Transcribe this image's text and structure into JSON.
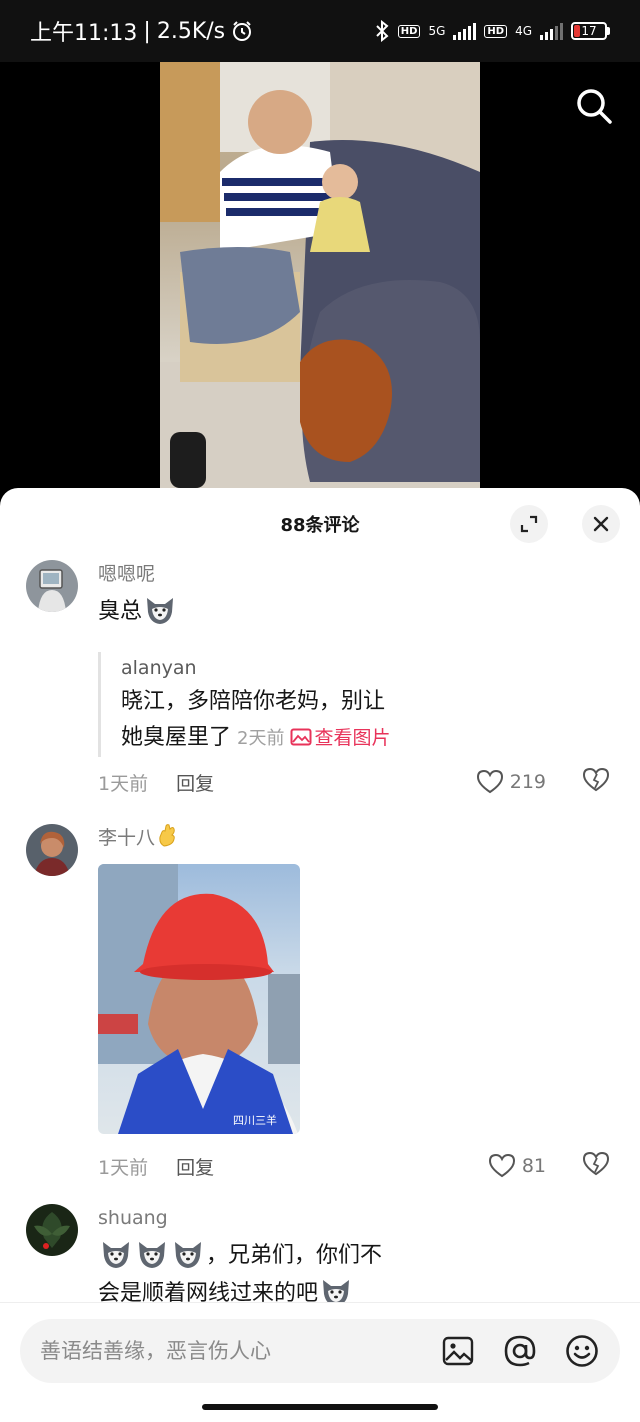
{
  "status_bar": {
    "time": "上午11:13",
    "network_speed": "2.5K/s",
    "signal_1": "5G",
    "signal_2": "4G",
    "hd_label": "HD",
    "battery": "17"
  },
  "comments_sheet": {
    "title": "88条评论"
  },
  "comments": [
    {
      "username": "嗯嗯呢",
      "text": "臭总",
      "quote": {
        "username": "alanyan",
        "line1": "晓江，多陪陪你老妈，别让",
        "line2": "她臭屋里了",
        "time": "2天前",
        "view_image": "查看图片"
      },
      "time": "1天前",
      "reply": "回复",
      "likes": "219"
    },
    {
      "username": "李十八",
      "time": "1天前",
      "reply": "回复",
      "likes": "81"
    },
    {
      "username": "shuang",
      "line1": "，兄弟们，你们不",
      "line2": "会是顺着网线过来的吧"
    }
  ],
  "input": {
    "placeholder": "善语结善缘，恶言伤人心"
  },
  "colors": {
    "accent": "#e8335a",
    "background": "#ffffff"
  }
}
